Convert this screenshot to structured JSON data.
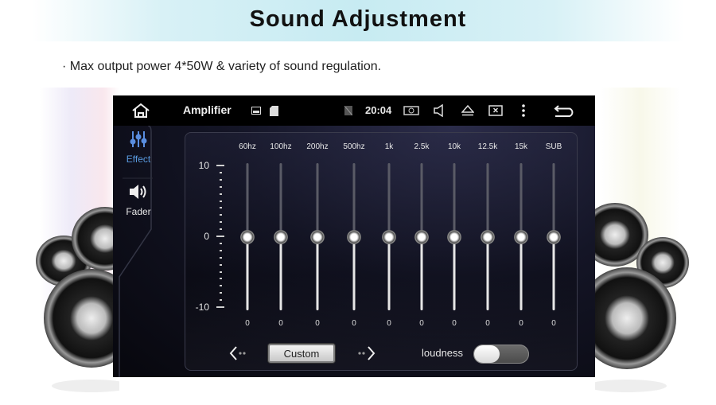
{
  "header": {
    "title": "Sound Adjustment",
    "subtitle": "· Max output power 4*50W & variety of sound regulation."
  },
  "device": {
    "statusbar": {
      "home_icon": "home-icon",
      "app_title": "Amplifier",
      "left_icons": [
        "image-icon",
        "sd-card-icon"
      ],
      "no-sim_icon": "no-sim-icon",
      "clock": "20:04",
      "right_icons": [
        "camera-icon",
        "volume-icon",
        "eject-icon",
        "close-window-icon",
        "more-icon"
      ],
      "back_icon": "back-icon"
    },
    "sidebar": {
      "items": [
        {
          "label": "Effect",
          "icon": "equalizer-icon",
          "active": true
        },
        {
          "label": "Fader",
          "icon": "speaker-icon",
          "active": false
        }
      ]
    },
    "equalizer": {
      "scale": {
        "max": 10,
        "min": -10,
        "labels": [
          "10",
          "0",
          "-10"
        ]
      },
      "bands": [
        {
          "label": "60hz",
          "value": 0,
          "value_text": "0"
        },
        {
          "label": "100hz",
          "value": 0,
          "value_text": "0"
        },
        {
          "label": "200hz",
          "value": 0,
          "value_text": "0"
        },
        {
          "label": "500hz",
          "value": 0,
          "value_text": "0"
        },
        {
          "label": "1k",
          "value": 0,
          "value_text": "0"
        },
        {
          "label": "2.5k",
          "value": 0,
          "value_text": "0"
        },
        {
          "label": "10k",
          "value": 0,
          "value_text": "0"
        },
        {
          "label": "12.5k",
          "value": 0,
          "value_text": "0"
        },
        {
          "label": "15k",
          "value": 0,
          "value_text": "0"
        },
        {
          "label": "SUB",
          "value": 0,
          "value_text": "0"
        }
      ],
      "preset_label": "Custom",
      "prev_icon": "chevron-left-icon",
      "next_icon": "chevron-right-icon",
      "loudness_label": "loudness",
      "loudness_on": false
    },
    "colors": {
      "accent": "#4a8fd6",
      "text": "#e8e8e8",
      "track": "#5a5b66"
    }
  }
}
